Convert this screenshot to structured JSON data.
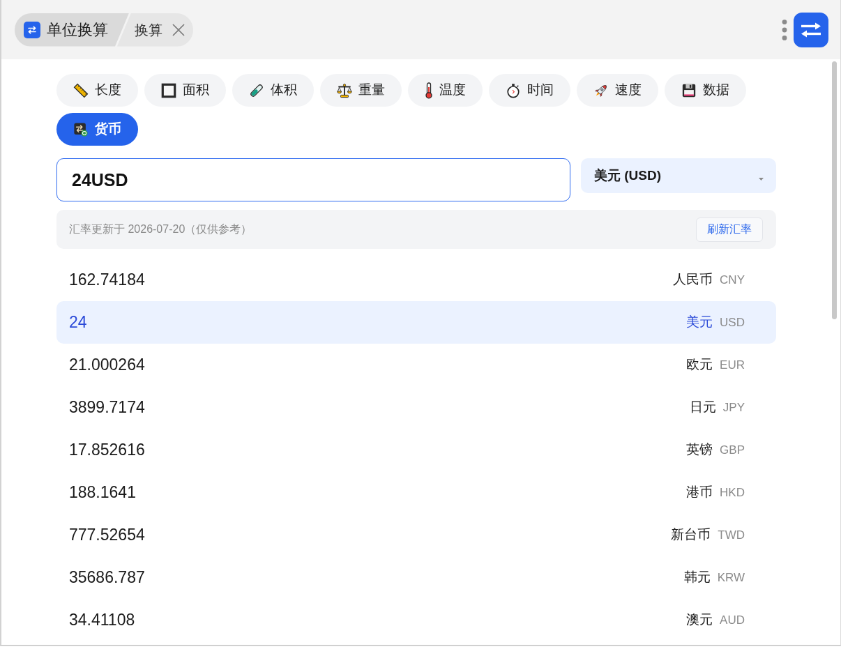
{
  "breadcrumb": {
    "app": "单位换算",
    "page": "换算"
  },
  "categories": [
    {
      "kind": "length",
      "label": "长度",
      "selected": false
    },
    {
      "kind": "area",
      "label": "面积",
      "selected": false
    },
    {
      "kind": "volume",
      "label": "体积",
      "selected": false
    },
    {
      "kind": "weight",
      "label": "重量",
      "selected": false
    },
    {
      "kind": "temperature",
      "label": "温度",
      "selected": false
    },
    {
      "kind": "time",
      "label": "时间",
      "selected": false
    },
    {
      "kind": "speed",
      "label": "速度",
      "selected": false
    },
    {
      "kind": "data",
      "label": "数据",
      "selected": false
    },
    {
      "kind": "currency",
      "label": "货币",
      "selected": true
    }
  ],
  "converter": {
    "value": "24USD",
    "unit": "美元 (USD)"
  },
  "rate_info": {
    "note": "汇率更新于 2026-07-20（仅供参考）",
    "refresh_button": "刷新汇率"
  },
  "results": [
    {
      "value": "162.74184",
      "name": "人民币",
      "code": "CNY",
      "selected": false
    },
    {
      "value": "24",
      "name": "美元",
      "code": "USD",
      "selected": true
    },
    {
      "value": "21.000264",
      "name": "欧元",
      "code": "EUR",
      "selected": false
    },
    {
      "value": "3899.7174",
      "name": "日元",
      "code": "JPY",
      "selected": false
    },
    {
      "value": "17.852616",
      "name": "英镑",
      "code": "GBP",
      "selected": false
    },
    {
      "value": "188.1641",
      "name": "港币",
      "code": "HKD",
      "selected": false
    },
    {
      "value": "777.52654",
      "name": "新台币",
      "code": "TWD",
      "selected": false
    },
    {
      "value": "35686.787",
      "name": "韩元",
      "code": "KRW",
      "selected": false
    },
    {
      "value": "34.41108",
      "name": "澳元",
      "code": "AUD",
      "selected": false
    }
  ]
}
